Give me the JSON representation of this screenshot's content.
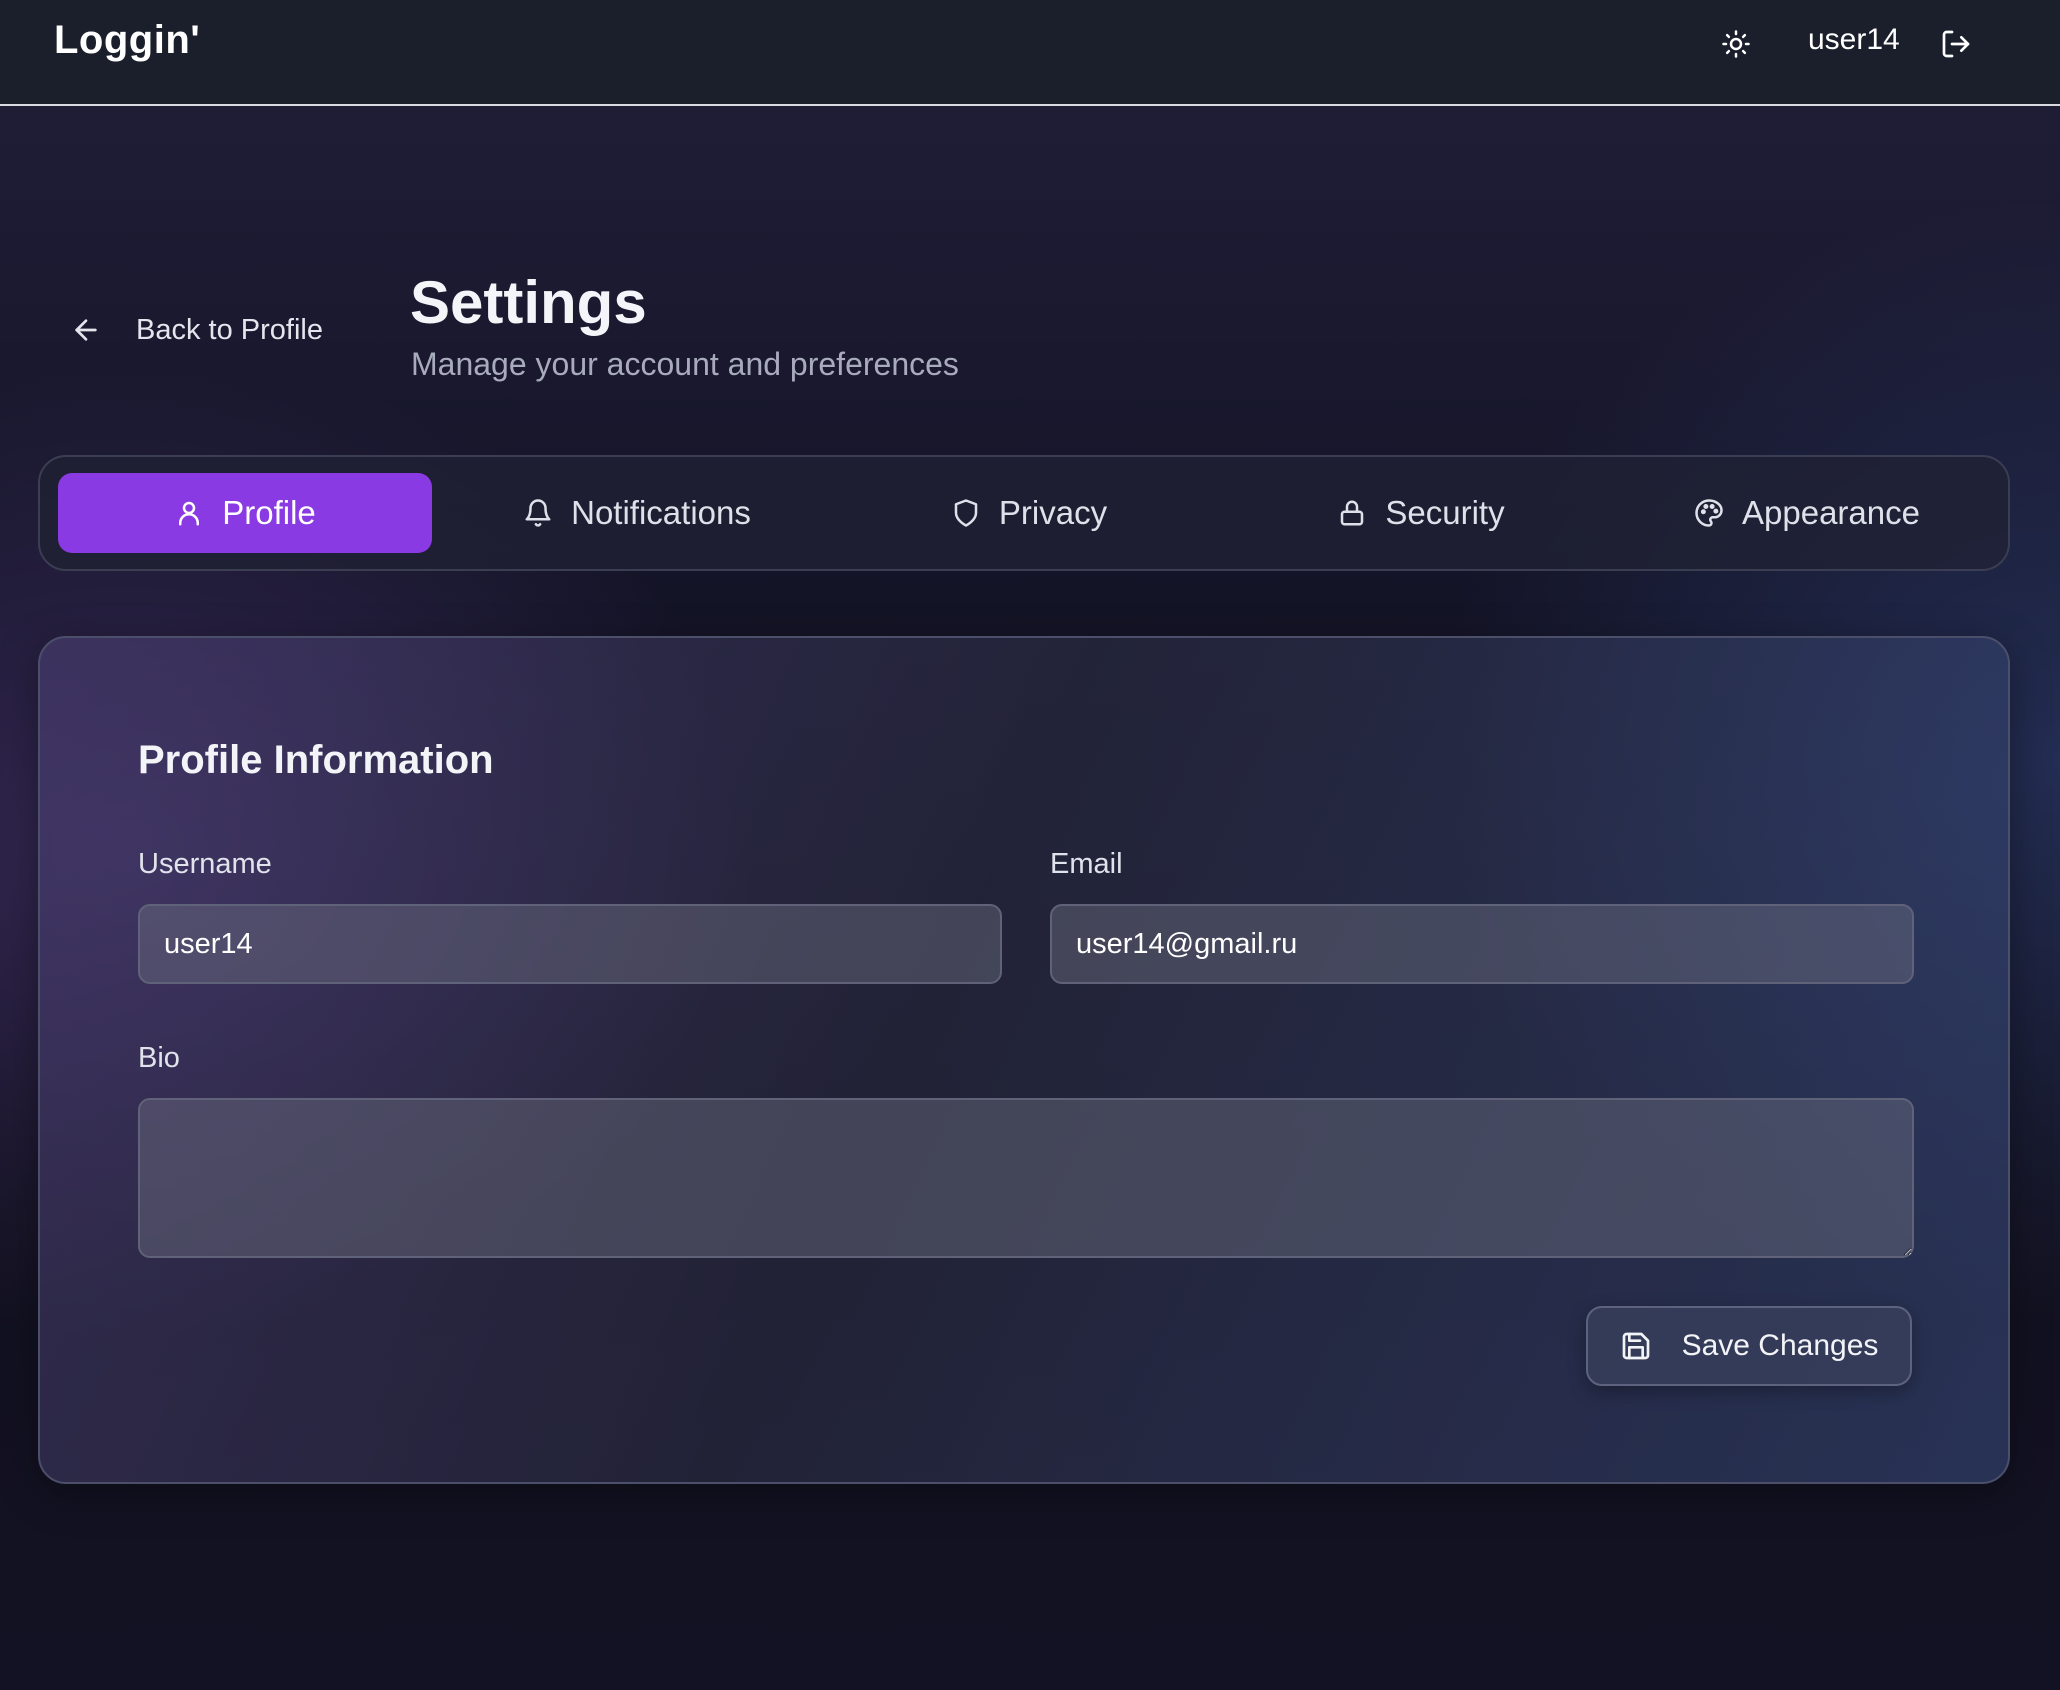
{
  "app": {
    "brand": "Loggin'",
    "username": "user14"
  },
  "icons": {
    "theme": "sun-icon",
    "logout": "log-out-icon",
    "back": "arrow-left-icon",
    "profile": "user-icon",
    "notifications": "bell-icon",
    "privacy": "shield-icon",
    "security": "lock-icon",
    "appearance": "palette-icon",
    "save": "save-icon"
  },
  "header": {
    "back_label": "Back to Profile",
    "title": "Settings",
    "subtitle": "Manage your account and preferences"
  },
  "tabs": [
    {
      "label": "Profile",
      "active": true
    },
    {
      "label": "Notifications",
      "active": false
    },
    {
      "label": "Privacy",
      "active": false
    },
    {
      "label": "Security",
      "active": false
    },
    {
      "label": "Appearance",
      "active": false
    }
  ],
  "profile_form": {
    "title": "Profile Information",
    "username_label": "Username",
    "username_value": "user14",
    "email_label": "Email",
    "email_value": "user14@gmail.ru",
    "bio_label": "Bio",
    "bio_value": "",
    "save_label": "Save Changes"
  },
  "colors": {
    "accent": "#8a3ae3",
    "topbar": "#1b1f2b"
  }
}
